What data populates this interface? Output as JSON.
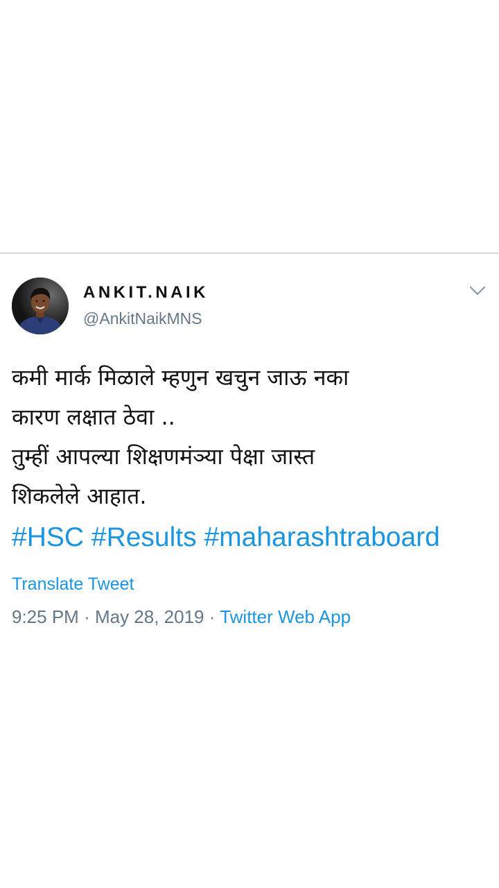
{
  "tweet": {
    "author": {
      "display_name": "ANKIT.NAIK",
      "handle": "@AnkitNaikMNS"
    },
    "lines": [
      "कमी मार्क मिळाले म्हणुन खचुन जाऊ नका",
      "कारण लक्षात ठेवा ..",
      "तुम्हीं आपल्या शिक्षणमंञ्या पेक्षा जास्त",
      "शिकलेले आहात."
    ],
    "hashtags": [
      "#HSC",
      "#Results",
      "#maharashtraboard"
    ],
    "translate_label": "Translate Tweet",
    "time": "9:25 PM",
    "date": "May 28, 2019",
    "separator": "·",
    "source": "Twitter Web App"
  },
  "icons": {
    "avatar": "profile-photo",
    "menu": "chevron-down-icon"
  },
  "colors": {
    "link": "#1b95e0",
    "secondary_text": "#657786",
    "primary_text": "#111111",
    "divider": "#d6d6d6"
  }
}
